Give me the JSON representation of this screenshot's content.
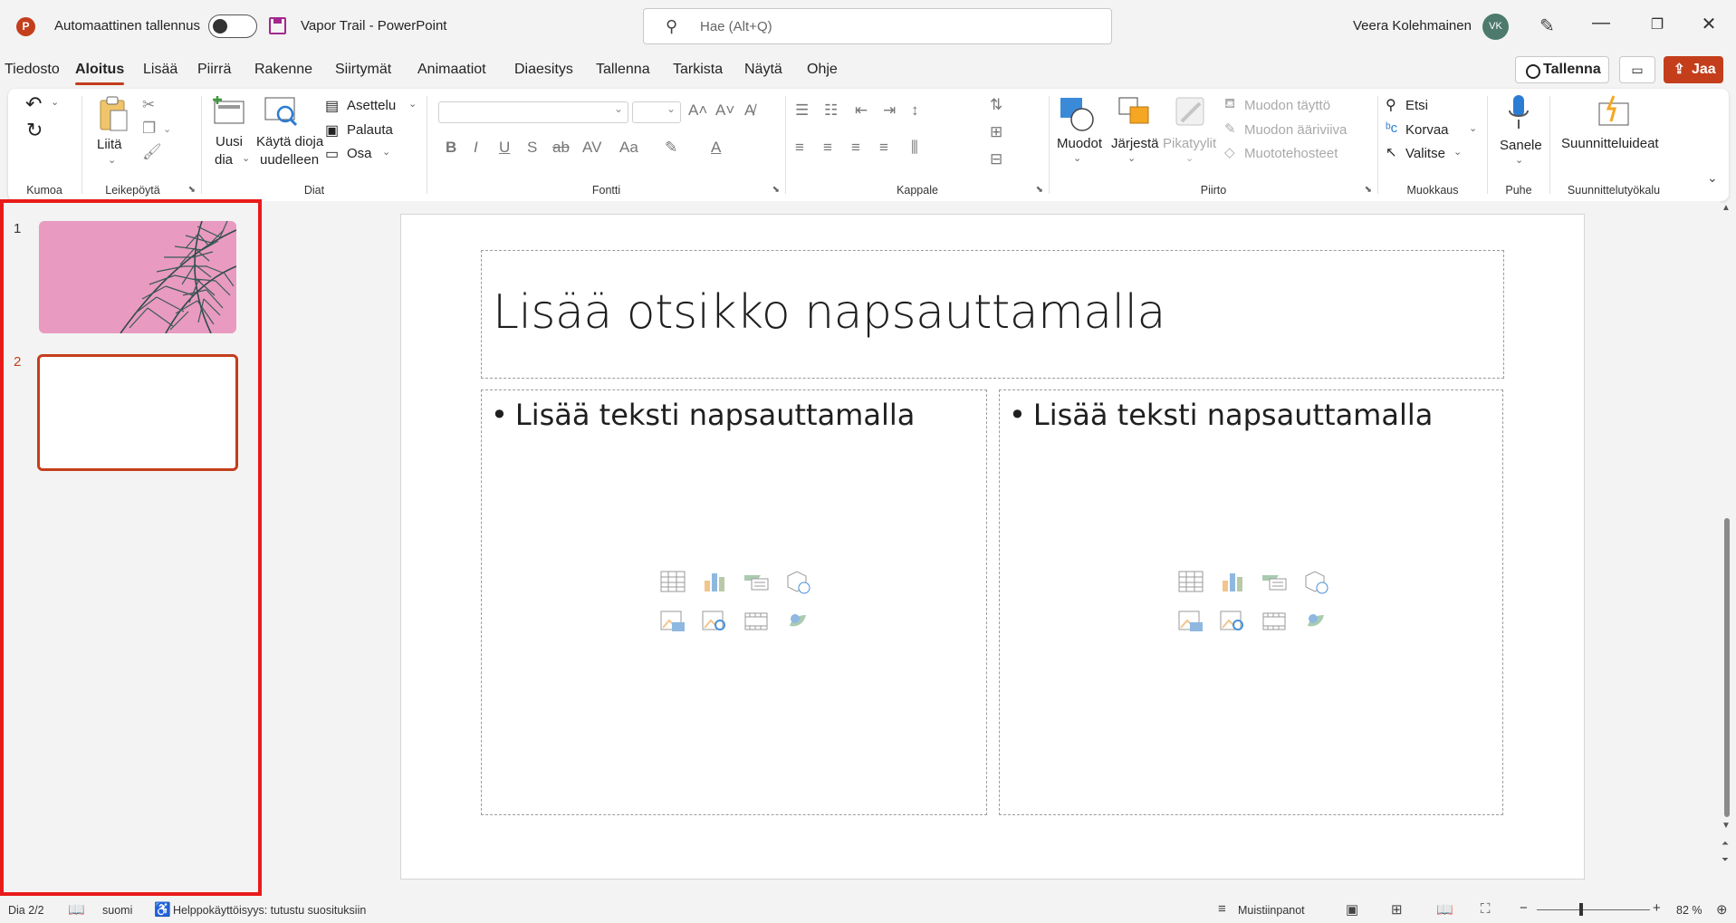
{
  "titlebar": {
    "app_icon_letter": "P",
    "autosave_label": "Automaattinen tallennus",
    "doc_title": "Vapor Trail  -  PowerPoint",
    "search_placeholder": "Hae (Alt+Q)",
    "user_name": "Veera Kolehmainen",
    "user_initials": "VK"
  },
  "menu_tabs": [
    "Tiedosto",
    "Aloitus",
    "Lisää",
    "Piirrä",
    "Rakenne",
    "Siirtymät",
    "Animaatiot",
    "Diaesitys",
    "Tallenna",
    "Tarkista",
    "Näytä",
    "Ohje"
  ],
  "active_tab": "Aloitus",
  "actions": {
    "save_label": "Tallenna",
    "share_label": "Jaa"
  },
  "ribbon": {
    "groups": {
      "undo": "Kumoa",
      "clipboard": "Leikepöytä",
      "slides": "Diat",
      "font": "Fontti",
      "paragraph": "Kappale",
      "drawing": "Piirto",
      "editing": "Muokkaus",
      "voice": "Puhe",
      "designer": "Suunnittelutyökalu"
    },
    "paste": "Liitä",
    "new_slide_1": "Uusi",
    "new_slide_2": "dia",
    "reuse_1": "Käytä dioja",
    "reuse_2": "uudelleen",
    "layout": "Asettelu",
    "reset": "Palauta",
    "section": "Osa",
    "shapes": "Muodot",
    "arrange": "Järjestä",
    "quick_styles": "Pikatyylit",
    "shape_fill": "Muodon täyttö",
    "shape_outline": "Muodon ääriviiva",
    "shape_effects": "Muototehosteet",
    "find": "Etsi",
    "replace": "Korvaa",
    "select": "Valitse",
    "dictate": "Sanele",
    "designer_ideas": "Suunnitteluideat"
  },
  "slides_panel": {
    "items": [
      {
        "number": "1"
      },
      {
        "number": "2"
      }
    ],
    "selected": "2"
  },
  "slide": {
    "title_placeholder": "Lisää otsikko napsauttamalla",
    "left_content_placeholder": "Lisää teksti napsauttamalla",
    "right_content_placeholder": "Lisää teksti napsauttamalla"
  },
  "statusbar": {
    "slide_indicator": "Dia 2/2",
    "language": "suomi",
    "accessibility": "Helppokäyttöisyys: tutustu suosituksiin",
    "notes": "Muistiinpanot",
    "zoom_percent": "82 %"
  },
  "colors": {
    "accent": "#c43e1c",
    "highlight_border": "#e81b1b",
    "avatar": "#4d7a6d"
  }
}
